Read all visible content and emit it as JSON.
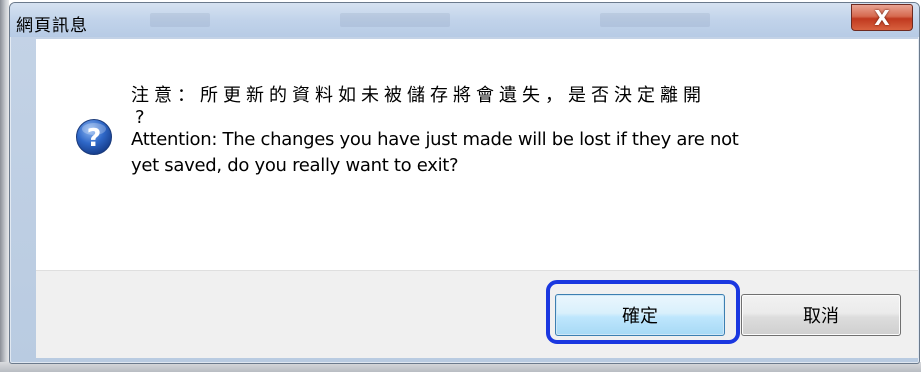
{
  "window": {
    "title": "網頁訊息",
    "close_label": "X"
  },
  "dialog": {
    "icon": "question-icon",
    "message_zh_line1": "注意：所更新的資料如未被儲存將會遺失，是否決定離開",
    "message_zh_line2": "?",
    "message_en_line1": "Attention: The changes you have just made will be lost if they are not",
    "message_en_line2": "yet saved, do you really want to exit?"
  },
  "buttons": {
    "ok_label": "確定",
    "cancel_label": "取消"
  },
  "colors": {
    "highlight": "#1a37e0",
    "close_button": "#c0391f",
    "icon_blue": "#2a5fbf"
  }
}
